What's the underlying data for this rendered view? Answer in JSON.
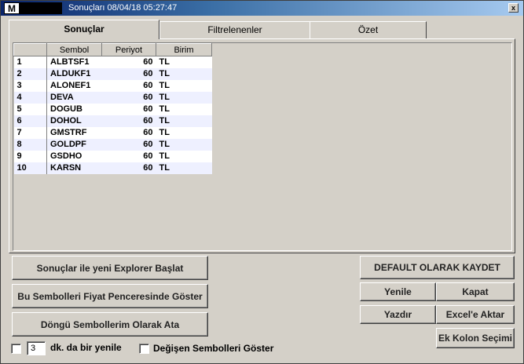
{
  "window": {
    "logo": "M",
    "title": "Sonuçları 08/04/18 05:27:47",
    "close_label": "x"
  },
  "tabs": [
    {
      "label": "Sonuçlar",
      "active": true
    },
    {
      "label": "Filtrelenenler",
      "active": false
    },
    {
      "label": "Özet",
      "active": false
    }
  ],
  "grid": {
    "columns": [
      "",
      "Sembol",
      "Periyot",
      "Birim"
    ],
    "rows": [
      {
        "idx": "1",
        "symbol": "ALBTSF1",
        "period": "60",
        "unit": "TL"
      },
      {
        "idx": "2",
        "symbol": "ALDUKF1",
        "period": "60",
        "unit": "TL"
      },
      {
        "idx": "3",
        "symbol": "ALONEF1",
        "period": "60",
        "unit": "TL"
      },
      {
        "idx": "4",
        "symbol": "DEVA",
        "period": "60",
        "unit": "TL"
      },
      {
        "idx": "5",
        "symbol": "DOGUB",
        "period": "60",
        "unit": "TL"
      },
      {
        "idx": "6",
        "symbol": "DOHOL",
        "period": "60",
        "unit": "TL"
      },
      {
        "idx": "7",
        "symbol": "GMSTRF",
        "period": "60",
        "unit": "TL"
      },
      {
        "idx": "8",
        "symbol": "GOLDPF",
        "period": "60",
        "unit": "TL"
      },
      {
        "idx": "9",
        "symbol": "GSDHO",
        "period": "60",
        "unit": "TL"
      },
      {
        "idx": "10",
        "symbol": "KARSN",
        "period": "60",
        "unit": "TL"
      }
    ]
  },
  "buttons": {
    "start_explorer": "Sonuçlar ile yeni Explorer Başlat",
    "show_in_price_window": "Bu Sembolleri Fiyat Penceresinde Göster",
    "assign_loop_symbols": "Döngü Sembollerim Olarak Ata",
    "save_default": "DEFAULT OLARAK KAYDET",
    "refresh": "Yenile",
    "close": "Kapat",
    "print": "Yazdır",
    "export_excel": "Excel'e Aktar",
    "extra_columns": "Ek Kolon Seçimi"
  },
  "footer": {
    "refresh_minutes_value": "3",
    "refresh_label": "dk. da bir yenile",
    "show_changed_label": "Değişen Sembolleri Göster"
  }
}
